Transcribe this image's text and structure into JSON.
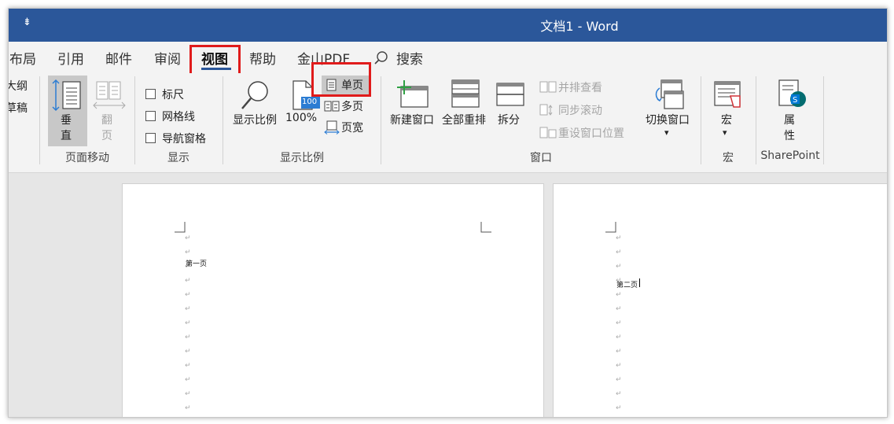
{
  "window": {
    "qat_label": "⇟",
    "title": "文档1  -  Word"
  },
  "tabs": [
    {
      "label": "布局"
    },
    {
      "label": "引用"
    },
    {
      "label": "邮件"
    },
    {
      "label": "审阅"
    },
    {
      "label": "视图",
      "active": true
    },
    {
      "label": "帮助"
    },
    {
      "label": "金山PDF"
    },
    {
      "label": "搜索"
    }
  ],
  "ribbon": {
    "views": {
      "outline_label": "大纲",
      "draft_label": "草稿"
    },
    "page_move": {
      "vertical_label_1": "垂",
      "vertical_label_2": "直",
      "flip_label_1": "翻",
      "flip_label_2": "页",
      "group_label": "页面移动"
    },
    "show": {
      "ruler_label": "标尺",
      "gridlines_label": "网格线",
      "nav_pane_label": "导航窗格",
      "group_label": "显示"
    },
    "zoom": {
      "zoom_label": "显示比例",
      "percent_label": "100%",
      "percent_icon_text": "100",
      "one_page_label": "单页",
      "multi_page_label": "多页",
      "page_width_label": "页宽",
      "group_label": "显示比例"
    },
    "window": {
      "new_window_label": "新建窗口",
      "arrange_all_label": "全部重排",
      "split_label": "拆分",
      "side_by_side_label": "并排查看",
      "sync_scroll_label": "同步滚动",
      "reset_position_label": "重设窗口位置",
      "switch_window_label": "切换窗口",
      "switch_caret": "▾",
      "group_label": "窗口"
    },
    "macros": {
      "macros_label": "宏",
      "caret": "▾",
      "group_label": "宏"
    },
    "sharepoint": {
      "properties_label_1": "属",
      "properties_label_2": "性",
      "group_label": "SharePoint"
    }
  },
  "document": {
    "page1_text": "第一页",
    "page2_text": "第二页"
  },
  "colors": {
    "titlebar": "#2b579a",
    "highlight": "#e01b1b",
    "accent_green": "#2ea043"
  }
}
